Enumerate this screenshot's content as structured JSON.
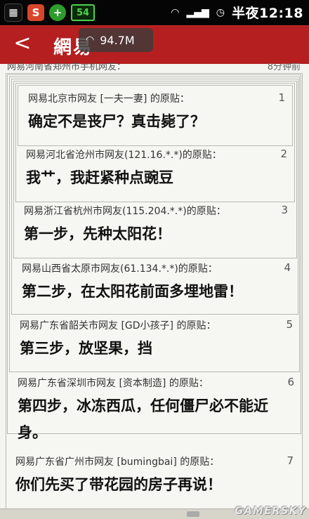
{
  "status_bar": {
    "icons": [
      "grid-icon",
      "s-app-icon",
      "plus-app-icon",
      "battery-icon"
    ],
    "battery_label": "54",
    "time": "半夜12:18"
  },
  "title_bar": {
    "back_label": "<",
    "title": "網易"
  },
  "network_overlay": {
    "speed": "94.7M"
  },
  "partial_post": {
    "author": "网易河南省郑州市手机网友：",
    "time": "8分钟前"
  },
  "posts": [
    {
      "num": "1",
      "author": "网易北京市网友 [一夫一妻] 的原贴：",
      "body": "确定不是丧尸？真击毙了？"
    },
    {
      "num": "2",
      "author": "网易河北省沧州市网友(121.16.*.*)的原贴：",
      "body": "我艹，我赶紧种点豌豆"
    },
    {
      "num": "3",
      "author": "网易浙江省杭州市网友(115.204.*.*)的原贴：",
      "body": "第一步，先种太阳花！"
    },
    {
      "num": "4",
      "author": "网易山西省太原市网友(61.134.*.*)的原贴：",
      "body": "第二步，在太阳花前面多埋地雷！"
    },
    {
      "num": "5",
      "author": "网易广东省韶关市网友 [GD小孩子] 的原贴：",
      "body": "第三步，放坚果，挡"
    },
    {
      "num": "6",
      "author": "网易广东省深圳市网友 [资本制造] 的原贴：",
      "body": "第四步，冰冻西瓜，任何僵尸必不能近身。"
    },
    {
      "num": "7",
      "author": "网易广东省广州市网友 [bumingbai] 的原贴：",
      "body": "你们先买了带花园的房子再说！"
    }
  ],
  "watermark": "GAMERSKY"
}
